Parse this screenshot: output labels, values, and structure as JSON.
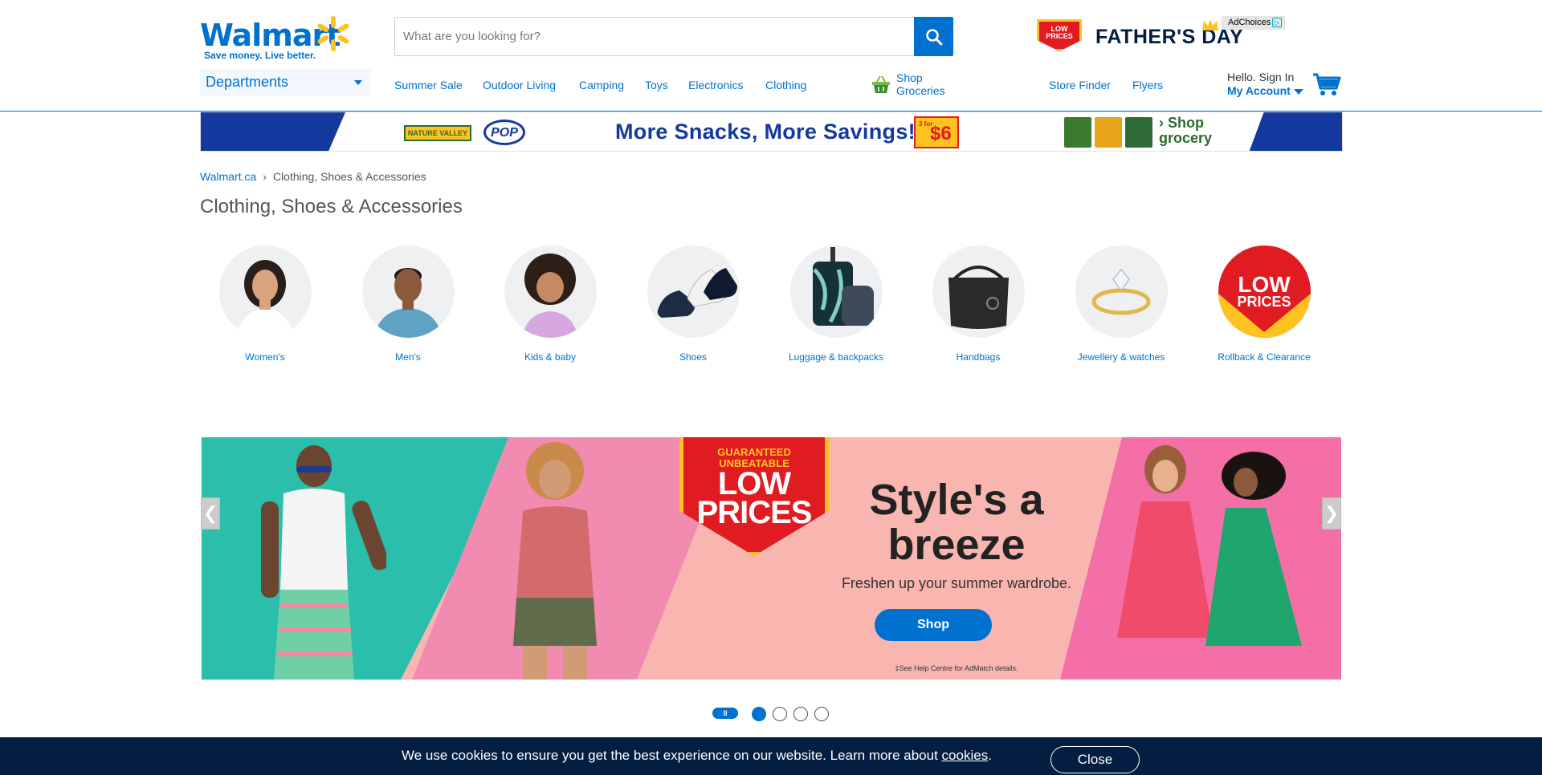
{
  "logo": {
    "word": "Walmart",
    "tagline": "Save money. Live better."
  },
  "search": {
    "placeholder": "What are you looking for?"
  },
  "promo": {
    "badge": "LOW PRICES",
    "text": "FATHER'S DAY",
    "adchoices": "AdChoices"
  },
  "departments": {
    "label": "Departments"
  },
  "nav": {
    "items": [
      "Summer Sale",
      "Outdoor Living",
      "Camping",
      "Toys",
      "Electronics",
      "Clothing"
    ],
    "grocery": "Shop Groceries",
    "store_finder": "Store Finder",
    "flyers": "Flyers"
  },
  "account": {
    "hello": "Hello. Sign In",
    "my_account": "My Account"
  },
  "ad_banner": {
    "brand1": "NATURE VALLEY",
    "brand2": "POP",
    "headline": "More Snacks, More Savings!",
    "price_small": "3 for",
    "price_big": "$6",
    "cta": "› Shop grocery"
  },
  "breadcrumb": {
    "home": "Walmart.ca",
    "separator": "›",
    "current": "Clothing, Shoes & Accessories"
  },
  "page_title": "Clothing, Shoes & Accessories",
  "categories": [
    {
      "label": "Women's"
    },
    {
      "label": "Men's"
    },
    {
      "label": "Kids & baby"
    },
    {
      "label": "Shoes"
    },
    {
      "label": "Luggage & backpacks"
    },
    {
      "label": "Handbags"
    },
    {
      "label": "Jewellery & watches"
    },
    {
      "label": "Rollback & Clearance"
    }
  ],
  "hero": {
    "badge_top": "GUARANTEED UNBEATABLE",
    "badge_main": "LOW PRICES",
    "title": "Style's a breeze",
    "subtitle": "Freshen up your summer wardrobe.",
    "button": "Shop",
    "fine_print": "‡See Help Centre for AdMatch details."
  },
  "carousel": {
    "prev": "❮",
    "next": "❯",
    "pause": "II",
    "slide_count": 4,
    "active_index": 0
  },
  "cookie": {
    "text": "We use cookies to ensure you get the best experience on our website. Learn more about ",
    "link": "cookies",
    "period": ".",
    "close": "Close"
  },
  "colors": {
    "brand_blue": "#0071ce",
    "spark_yellow": "#ffc220",
    "navy": "#041e42",
    "red": "#e01b22"
  }
}
